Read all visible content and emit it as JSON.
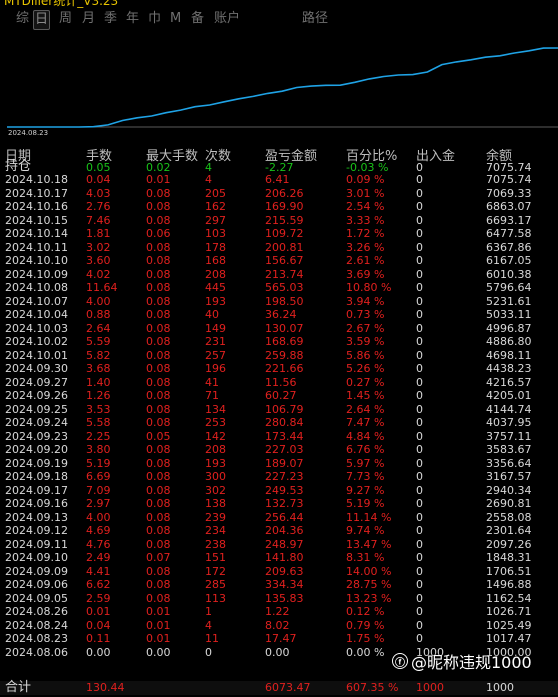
{
  "title": "MTDiller统计_V3.23",
  "tabs": [
    "综",
    "日",
    "周",
    "月",
    "季",
    "年",
    "巾",
    "M",
    "备",
    "账户",
    "路径"
  ],
  "active_tab": "日",
  "chart": {
    "start_date": "2024.08.23",
    "line_color": "#1fa3e6",
    "values": [
      1000,
      1026.71,
      1162.54,
      1496.88,
      1706.51,
      1848.31,
      2097.26,
      2301.64,
      2558.08,
      2690.81,
      2940.34,
      3167.57,
      3356.64,
      3583.67,
      3757.11,
      4037.95,
      4144.74,
      4205.01,
      4216.57,
      4438.23,
      4698.11,
      4886.8,
      4996.87,
      5033.11,
      5231.61,
      5796.64,
      6010.38,
      6167.05,
      6367.86,
      6477.58,
      6693.17,
      6863.07,
      7069.33,
      7075.74
    ]
  },
  "headers": [
    "日期",
    "手数",
    "最大手数",
    "次数",
    "盈亏金额",
    "百分比%",
    "出入金",
    "余额"
  ],
  "holdings": {
    "label": "持仓",
    "lots": "0.05",
    "max_lots": "0.02",
    "count": "4",
    "pnl": "-2.27",
    "pct": "-0.03 %",
    "deposit": "0",
    "balance": "7075.74"
  },
  "rows": [
    {
      "date": "2024.10.18",
      "lots": "0.04",
      "max_lots": "0.01",
      "count": "4",
      "pnl": "6.41",
      "pct": "0.09 %",
      "deposit": "0",
      "balance": "7075.74"
    },
    {
      "date": "2024.10.17",
      "lots": "4.03",
      "max_lots": "0.08",
      "count": "205",
      "pnl": "206.26",
      "pct": "3.01 %",
      "deposit": "0",
      "balance": "7069.33"
    },
    {
      "date": "2024.10.16",
      "lots": "2.76",
      "max_lots": "0.08",
      "count": "162",
      "pnl": "169.90",
      "pct": "2.54 %",
      "deposit": "0",
      "balance": "6863.07"
    },
    {
      "date": "2024.10.15",
      "lots": "7.46",
      "max_lots": "0.08",
      "count": "297",
      "pnl": "215.59",
      "pct": "3.33 %",
      "deposit": "0",
      "balance": "6693.17"
    },
    {
      "date": "2024.10.14",
      "lots": "1.81",
      "max_lots": "0.06",
      "count": "103",
      "pnl": "109.72",
      "pct": "1.72 %",
      "deposit": "0",
      "balance": "6477.58"
    },
    {
      "date": "2024.10.11",
      "lots": "3.02",
      "max_lots": "0.08",
      "count": "178",
      "pnl": "200.81",
      "pct": "3.26 %",
      "deposit": "0",
      "balance": "6367.86"
    },
    {
      "date": "2024.10.10",
      "lots": "3.60",
      "max_lots": "0.08",
      "count": "168",
      "pnl": "156.67",
      "pct": "2.61 %",
      "deposit": "0",
      "balance": "6167.05"
    },
    {
      "date": "2024.10.09",
      "lots": "4.02",
      "max_lots": "0.08",
      "count": "208",
      "pnl": "213.74",
      "pct": "3.69 %",
      "deposit": "0",
      "balance": "6010.38"
    },
    {
      "date": "2024.10.08",
      "lots": "11.64",
      "max_lots": "0.08",
      "count": "445",
      "pnl": "565.03",
      "pct": "10.80 %",
      "deposit": "0",
      "balance": "5796.64"
    },
    {
      "date": "2024.10.07",
      "lots": "4.00",
      "max_lots": "0.08",
      "count": "193",
      "pnl": "198.50",
      "pct": "3.94 %",
      "deposit": "0",
      "balance": "5231.61"
    },
    {
      "date": "2024.10.04",
      "lots": "0.88",
      "max_lots": "0.08",
      "count": "40",
      "pnl": "36.24",
      "pct": "0.73 %",
      "deposit": "0",
      "balance": "5033.11"
    },
    {
      "date": "2024.10.03",
      "lots": "2.64",
      "max_lots": "0.08",
      "count": "149",
      "pnl": "130.07",
      "pct": "2.67 %",
      "deposit": "0",
      "balance": "4996.87"
    },
    {
      "date": "2024.10.02",
      "lots": "5.59",
      "max_lots": "0.08",
      "count": "231",
      "pnl": "168.69",
      "pct": "3.59 %",
      "deposit": "0",
      "balance": "4886.80"
    },
    {
      "date": "2024.10.01",
      "lots": "5.82",
      "max_lots": "0.08",
      "count": "257",
      "pnl": "259.88",
      "pct": "5.86 %",
      "deposit": "0",
      "balance": "4698.11"
    },
    {
      "date": "2024.09.30",
      "lots": "3.68",
      "max_lots": "0.08",
      "count": "196",
      "pnl": "221.66",
      "pct": "5.26 %",
      "deposit": "0",
      "balance": "4438.23"
    },
    {
      "date": "2024.09.27",
      "lots": "1.40",
      "max_lots": "0.08",
      "count": "41",
      "pnl": "11.56",
      "pct": "0.27 %",
      "deposit": "0",
      "balance": "4216.57"
    },
    {
      "date": "2024.09.26",
      "lots": "1.26",
      "max_lots": "0.08",
      "count": "71",
      "pnl": "60.27",
      "pct": "1.45 %",
      "deposit": "0",
      "balance": "4205.01"
    },
    {
      "date": "2024.09.25",
      "lots": "3.53",
      "max_lots": "0.08",
      "count": "134",
      "pnl": "106.79",
      "pct": "2.64 %",
      "deposit": "0",
      "balance": "4144.74"
    },
    {
      "date": "2024.09.24",
      "lots": "5.58",
      "max_lots": "0.08",
      "count": "253",
      "pnl": "280.84",
      "pct": "7.47 %",
      "deposit": "0",
      "balance": "4037.95"
    },
    {
      "date": "2024.09.23",
      "lots": "2.25",
      "max_lots": "0.05",
      "count": "142",
      "pnl": "173.44",
      "pct": "4.84 %",
      "deposit": "0",
      "balance": "3757.11"
    },
    {
      "date": "2024.09.20",
      "lots": "3.80",
      "max_lots": "0.08",
      "count": "208",
      "pnl": "227.03",
      "pct": "6.76 %",
      "deposit": "0",
      "balance": "3583.67"
    },
    {
      "date": "2024.09.19",
      "lots": "5.19",
      "max_lots": "0.08",
      "count": "193",
      "pnl": "189.07",
      "pct": "5.97 %",
      "deposit": "0",
      "balance": "3356.64"
    },
    {
      "date": "2024.09.18",
      "lots": "6.69",
      "max_lots": "0.08",
      "count": "300",
      "pnl": "227.23",
      "pct": "7.73 %",
      "deposit": "0",
      "balance": "3167.57"
    },
    {
      "date": "2024.09.17",
      "lots": "7.09",
      "max_lots": "0.08",
      "count": "302",
      "pnl": "249.53",
      "pct": "9.27 %",
      "deposit": "0",
      "balance": "2940.34"
    },
    {
      "date": "2024.09.16",
      "lots": "2.97",
      "max_lots": "0.08",
      "count": "138",
      "pnl": "132.73",
      "pct": "5.19 %",
      "deposit": "0",
      "balance": "2690.81"
    },
    {
      "date": "2024.09.13",
      "lots": "4.00",
      "max_lots": "0.08",
      "count": "239",
      "pnl": "256.44",
      "pct": "11.14 %",
      "deposit": "0",
      "balance": "2558.08"
    },
    {
      "date": "2024.09.12",
      "lots": "4.69",
      "max_lots": "0.08",
      "count": "234",
      "pnl": "204.36",
      "pct": "9.74 %",
      "deposit": "0",
      "balance": "2301.64"
    },
    {
      "date": "2024.09.11",
      "lots": "4.76",
      "max_lots": "0.08",
      "count": "238",
      "pnl": "248.97",
      "pct": "13.47 %",
      "deposit": "0",
      "balance": "2097.26"
    },
    {
      "date": "2024.09.10",
      "lots": "2.49",
      "max_lots": "0.07",
      "count": "151",
      "pnl": "141.80",
      "pct": "8.31 %",
      "deposit": "0",
      "balance": "1848.31"
    },
    {
      "date": "2024.09.09",
      "lots": "4.41",
      "max_lots": "0.08",
      "count": "172",
      "pnl": "209.63",
      "pct": "14.00 %",
      "deposit": "0",
      "balance": "1706.51"
    },
    {
      "date": "2024.09.06",
      "lots": "6.62",
      "max_lots": "0.08",
      "count": "285",
      "pnl": "334.34",
      "pct": "28.75 %",
      "deposit": "0",
      "balance": "1496.88"
    },
    {
      "date": "2024.09.05",
      "lots": "2.59",
      "max_lots": "0.08",
      "count": "113",
      "pnl": "135.83",
      "pct": "13.23 %",
      "deposit": "0",
      "balance": "1162.54"
    },
    {
      "date": "2024.08.26",
      "lots": "0.01",
      "max_lots": "0.01",
      "count": "1",
      "pnl": "1.22",
      "pct": "0.12 %",
      "deposit": "0",
      "balance": "1026.71"
    },
    {
      "date": "2024.08.24",
      "lots": "0.04",
      "max_lots": "0.01",
      "count": "4",
      "pnl": "8.02",
      "pct": "0.79 %",
      "deposit": "0",
      "balance": "1025.49"
    },
    {
      "date": "2024.08.23",
      "lots": "0.11",
      "max_lots": "0.01",
      "count": "11",
      "pnl": "17.47",
      "pct": "1.75 %",
      "deposit": "0",
      "balance": "1017.47"
    },
    {
      "date": "2024.08.06",
      "lots": "0.00",
      "max_lots": "0.00",
      "count": "0",
      "pnl": "0.00",
      "pct": "0.00 %",
      "deposit": "1000",
      "balance": "1000.00"
    }
  ],
  "total": {
    "label": "合计",
    "lots": "130.44",
    "pnl": "6073.47",
    "pct": "607.35 %",
    "deposit": "1000",
    "balance": "1000"
  },
  "watermark": {
    "icon": "weibo-icon",
    "text": "@昵称违规1000"
  },
  "colors": {
    "positive": "#e0201e",
    "negative": "#19c119",
    "neutral": "#d8d8d8",
    "header": "#bdbdbd",
    "line": "#1fa3e6"
  }
}
